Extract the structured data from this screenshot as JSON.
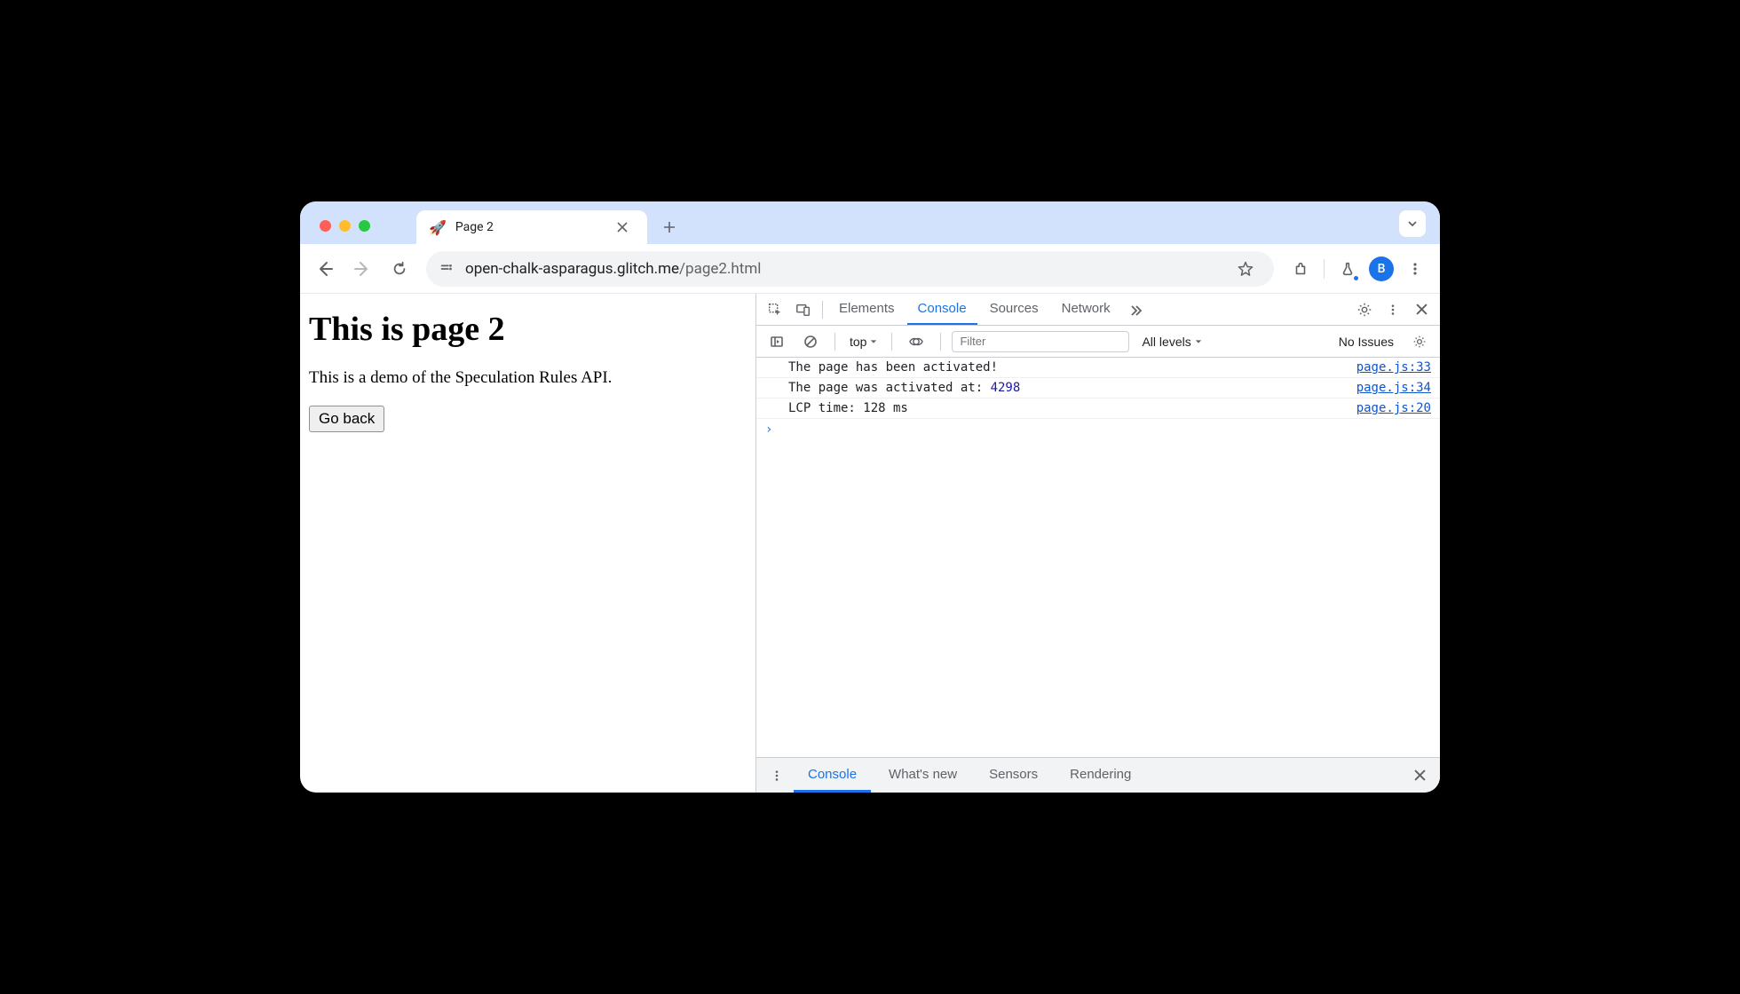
{
  "browser": {
    "tab": {
      "favicon": "🚀",
      "title": "Page 2"
    },
    "url_host": "open-chalk-asparagus.glitch.me",
    "url_path": "/page2.html",
    "avatar_initial": "B"
  },
  "page": {
    "heading": "This is page 2",
    "description": "This is a demo of the Speculation Rules API.",
    "button_label": "Go back"
  },
  "devtools": {
    "tabs": [
      "Elements",
      "Console",
      "Sources",
      "Network"
    ],
    "active_tab": "Console",
    "console_toolbar": {
      "context": "top",
      "filter_placeholder": "Filter",
      "levels": "All levels",
      "issues": "No Issues"
    },
    "logs": [
      {
        "msg_pre": "The page has been activated!",
        "msg_num": "",
        "msg_post": "",
        "src": "page.js:33"
      },
      {
        "msg_pre": "The page was activated at: ",
        "msg_num": "4298",
        "msg_post": "",
        "src": "page.js:34"
      },
      {
        "msg_pre": "LCP time: 128 ms",
        "msg_num": "",
        "msg_post": "",
        "src": "page.js:20"
      }
    ],
    "prompt": "›",
    "drawer_tabs": [
      "Console",
      "What's new",
      "Sensors",
      "Rendering"
    ],
    "drawer_active": "Console"
  }
}
